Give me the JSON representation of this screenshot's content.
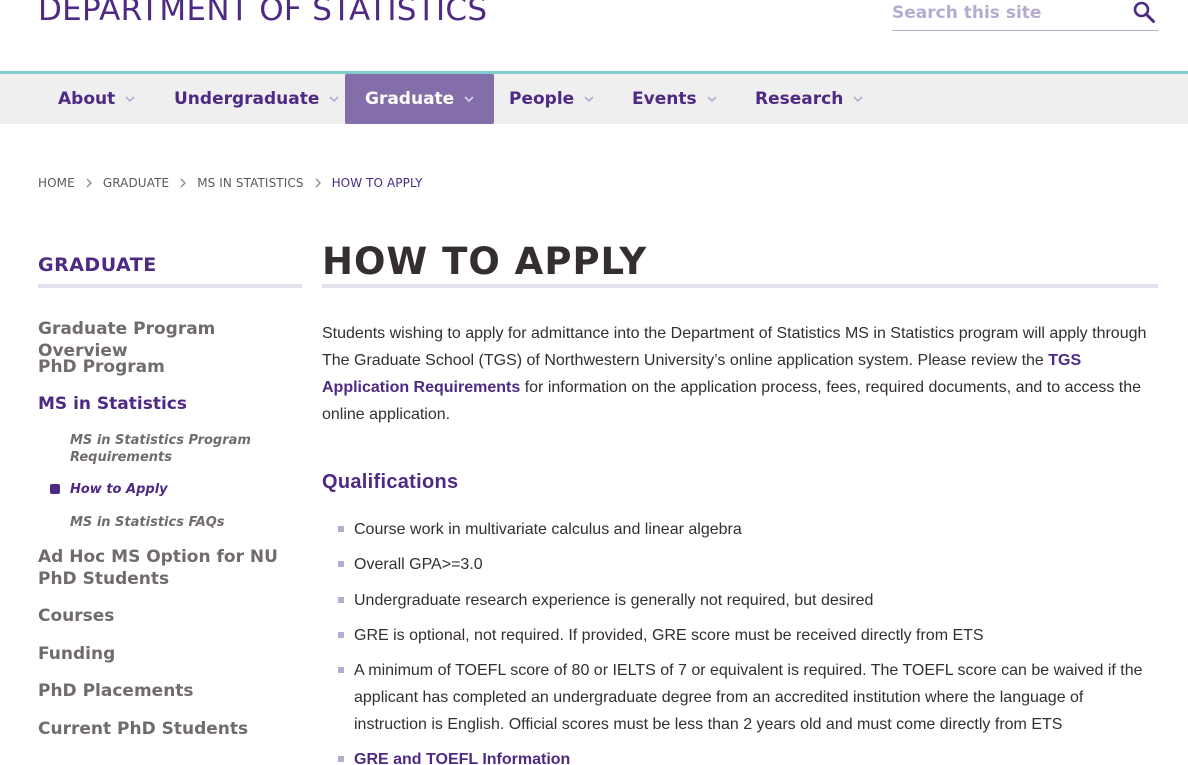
{
  "header": {
    "site_title": "DEPARTMENT OF STATISTICS",
    "search_placeholder": "Search this site"
  },
  "nav": {
    "items": [
      {
        "label": "About"
      },
      {
        "label": "Undergraduate"
      },
      {
        "label": "Graduate"
      },
      {
        "label": "People"
      },
      {
        "label": "Events"
      },
      {
        "label": "Research"
      }
    ]
  },
  "breadcrumb": {
    "items": [
      "HOME",
      "GRADUATE",
      "MS IN STATISTICS",
      "HOW TO APPLY"
    ]
  },
  "sidebar": {
    "title": "GRADUATE",
    "links": [
      "Graduate Program Overview",
      "PhD Program",
      "MS in Statistics",
      "Ad Hoc MS Option for NU PhD Students",
      "Courses",
      "Funding",
      "PhD Placements",
      "Current PhD Students"
    ],
    "sublinks": [
      "MS in Statistics Program Requirements",
      "How to Apply",
      "MS in Statistics FAQs"
    ]
  },
  "main": {
    "title": "HOW TO APPLY",
    "intro_before": "Students wishing to apply for admittance into the Department of Statistics MS in Statistics program will apply through The Graduate School (TGS) of Northwestern University’s online application system. Please review the ",
    "intro_link": "TGS Application Requirements",
    "intro_after": " for information on the application process, fees, required documents, and to access the online application.",
    "section_title": "Qualifications",
    "qualifications": [
      "Course work in multivariate calculus and linear algebra",
      "Overall GPA>=3.0",
      "Undergraduate research experience is generally not required, but desired",
      "GRE is optional, not required. If provided, GRE score must be received directly from ETS",
      "A minimum of TOEFL score of 80 or IELTS of 7 or equivalent is required. The TOEFL score can be waived if the applicant has completed an undergraduate degree from an accredited institution where the language of instruction is English. Official scores must be less than 2 years old and must come directly from ETS"
    ],
    "qual_link": "GRE and TOEFL Information"
  },
  "colors": {
    "brand_purple": "#4e2a84",
    "nav_active": "#836eaa",
    "accent_teal": "#7fcecd",
    "light_purple": "#b6acd1"
  }
}
